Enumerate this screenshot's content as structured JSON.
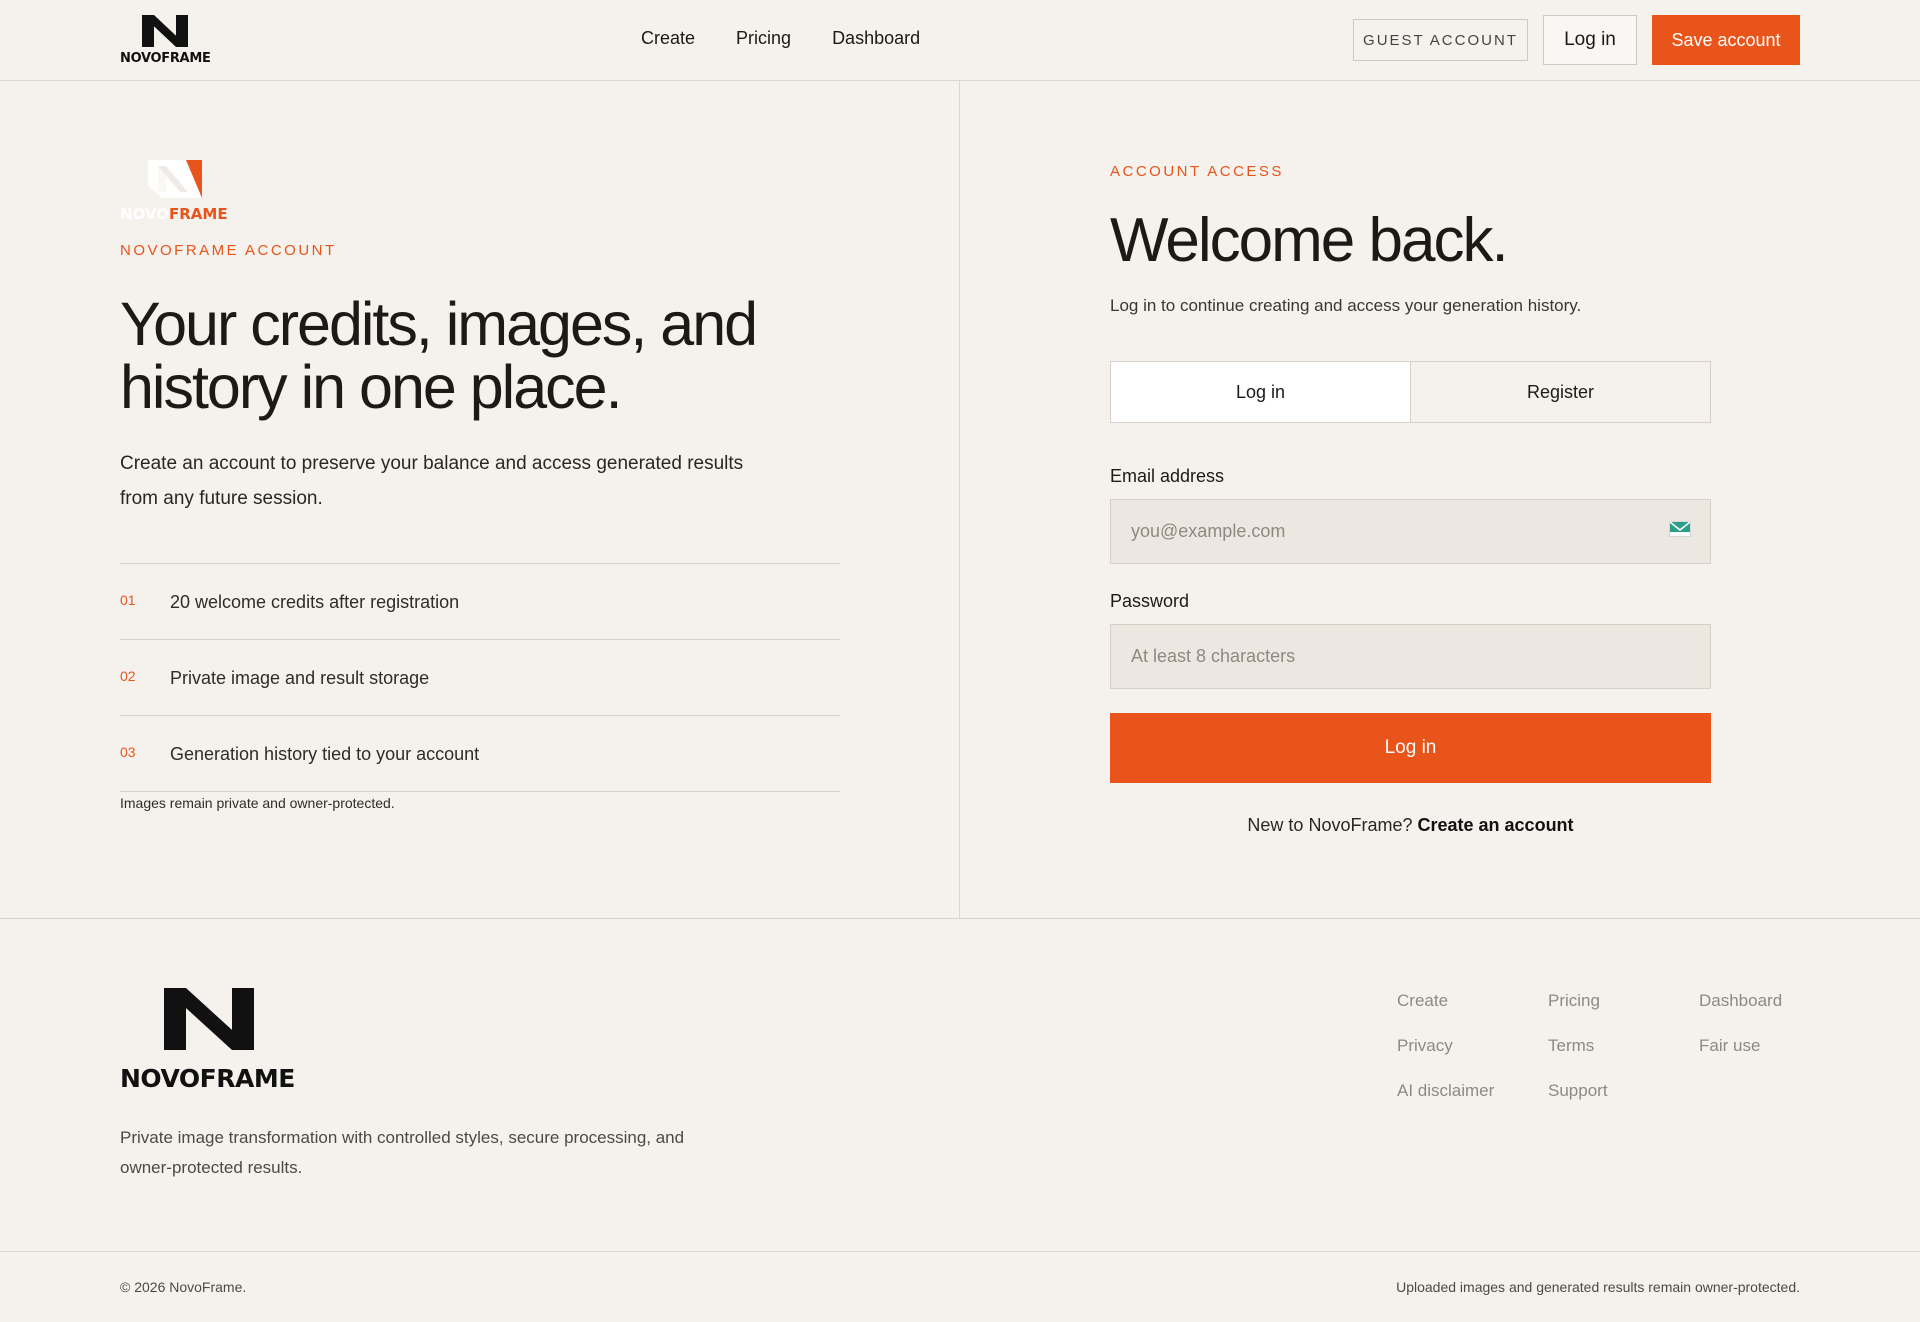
{
  "header": {
    "logo_text": "NOVOFRAME",
    "nav": [
      "Create",
      "Pricing",
      "Dashboard"
    ],
    "guest_label": "GUEST ACCOUNT",
    "login_label": "Log in",
    "save_label": "Save account"
  },
  "left": {
    "brand_mark": {
      "part1": "NOVO",
      "part2": "FRAME"
    },
    "eyebrow": "NOVOFRAME ACCOUNT",
    "title": "Your credits, images, and history in one place.",
    "subtitle": "Create an account to preserve your balance and access generated results from any future session.",
    "features": [
      {
        "num": "01",
        "text": "20 welcome credits after registration"
      },
      {
        "num": "02",
        "text": "Private image and result storage"
      },
      {
        "num": "03",
        "text": "Generation history tied to your account"
      }
    ],
    "note": "Images remain private and owner-protected."
  },
  "right": {
    "eyebrow": "ACCOUNT ACCESS",
    "title": "Welcome back.",
    "subtitle": "Log in to continue creating and access your generation history.",
    "tabs": [
      "Log in",
      "Register"
    ],
    "email_label": "Email address",
    "email_placeholder": "you@example.com",
    "password_label": "Password",
    "password_placeholder": "At least 8 characters",
    "submit_label": "Log in",
    "switch_prefix": "New to NovoFrame?",
    "switch_link": "Create an account"
  },
  "footer": {
    "logo_text": "NOVOFRAME",
    "description": "Private image transformation with controlled styles, secure processing, and owner-protected results.",
    "links": [
      "Create",
      "Pricing",
      "Dashboard",
      "Privacy",
      "Terms",
      "Fair use",
      "AI disclaimer",
      "Support"
    ],
    "copyright": "© 2026 NovoFrame.",
    "legal": "Uploaded images and generated results remain owner-protected."
  },
  "colors": {
    "accent": "#e8541a",
    "background": "#f5f2ed",
    "text": "#1c1a17"
  },
  "icons": {
    "email_field": "mail-icon",
    "logo": "novoframe-n-logo"
  }
}
